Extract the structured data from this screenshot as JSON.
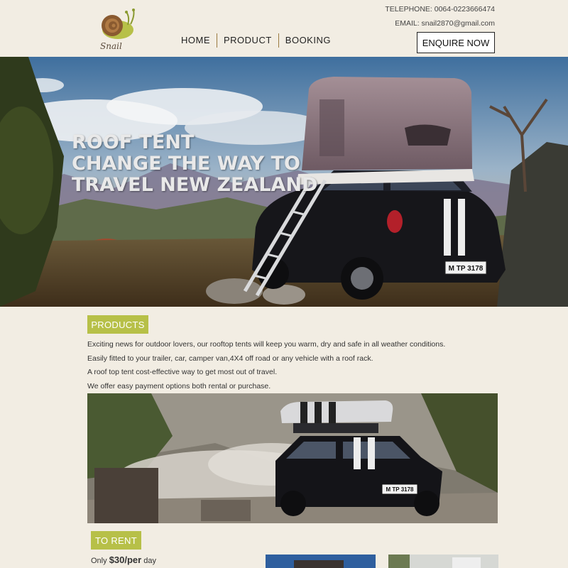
{
  "brand": {
    "name": "Snail"
  },
  "nav": {
    "items": [
      "HOME",
      "PRODUCT",
      "BOOKING"
    ]
  },
  "contact": {
    "phone": "TELEPHONE: 0064-0223666474",
    "email": "EMAIL: snail2870@gmail.com",
    "enquire_label": "ENQUIRE NOW"
  },
  "hero": {
    "line1": "ROOF TENT",
    "line2": "CHANGE THE WAY TO",
    "line3": "TRAVEL NEW ZEALAND",
    "plate": "M TP 3178"
  },
  "products": {
    "heading": "PRODUCTS",
    "paragraphs": [
      "Exciting news for outdoor lovers, our rooftop tents will keep you warm, dry and safe in all weather conditions.",
      "Easily fitted to your trailer, car, camper van,4X4 off road or any vehicle with a roof rack.",
      "A roof top tent cost-effective way to get most out of travel.",
      "We offer easy payment options both rental or purchase."
    ],
    "photo_plate": "M TP 3178"
  },
  "rent": {
    "heading": "TO RENT",
    "price_prefix": "Only ",
    "price_value": "$30/per",
    "price_suffix": " day"
  },
  "colors": {
    "accent": "#b7c048",
    "background": "#f2ede3",
    "nav_divider": "#9b7a3f"
  },
  "icons": {
    "logo": "snail-logo-icon"
  }
}
